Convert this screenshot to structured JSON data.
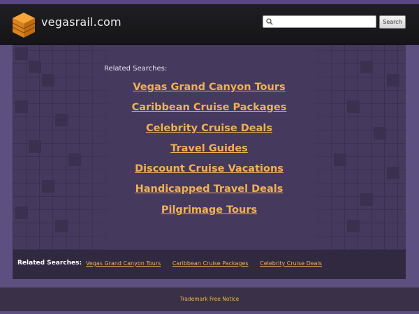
{
  "header": {
    "site_name": "vegasrail.com",
    "logo_icon": "orange-cube-stack-icon",
    "search": {
      "placeholder": "",
      "value": "",
      "button_label": "Search"
    }
  },
  "main": {
    "related_heading": "Related Searches:",
    "links": [
      "Vegas Grand Canyon Tours",
      "Caribbean Cruise Packages",
      "Celebrity Cruise Deals",
      "Travel Guides",
      "Discount Cruise Vacations",
      "Handicapped Travel Deals",
      "Pilgrimage Tours"
    ]
  },
  "footer": {
    "label": "Related Searches:",
    "links": [
      "Vegas Grand Canyon Tours",
      "Caribbean Cruise Packages",
      "Celebrity Cruise Deals"
    ],
    "trademark": "Trademark Free Notice"
  },
  "colors": {
    "background": "#5d4f7f",
    "header": "#1c1c1f",
    "panel": "#45395d",
    "link": "#f0b155"
  }
}
